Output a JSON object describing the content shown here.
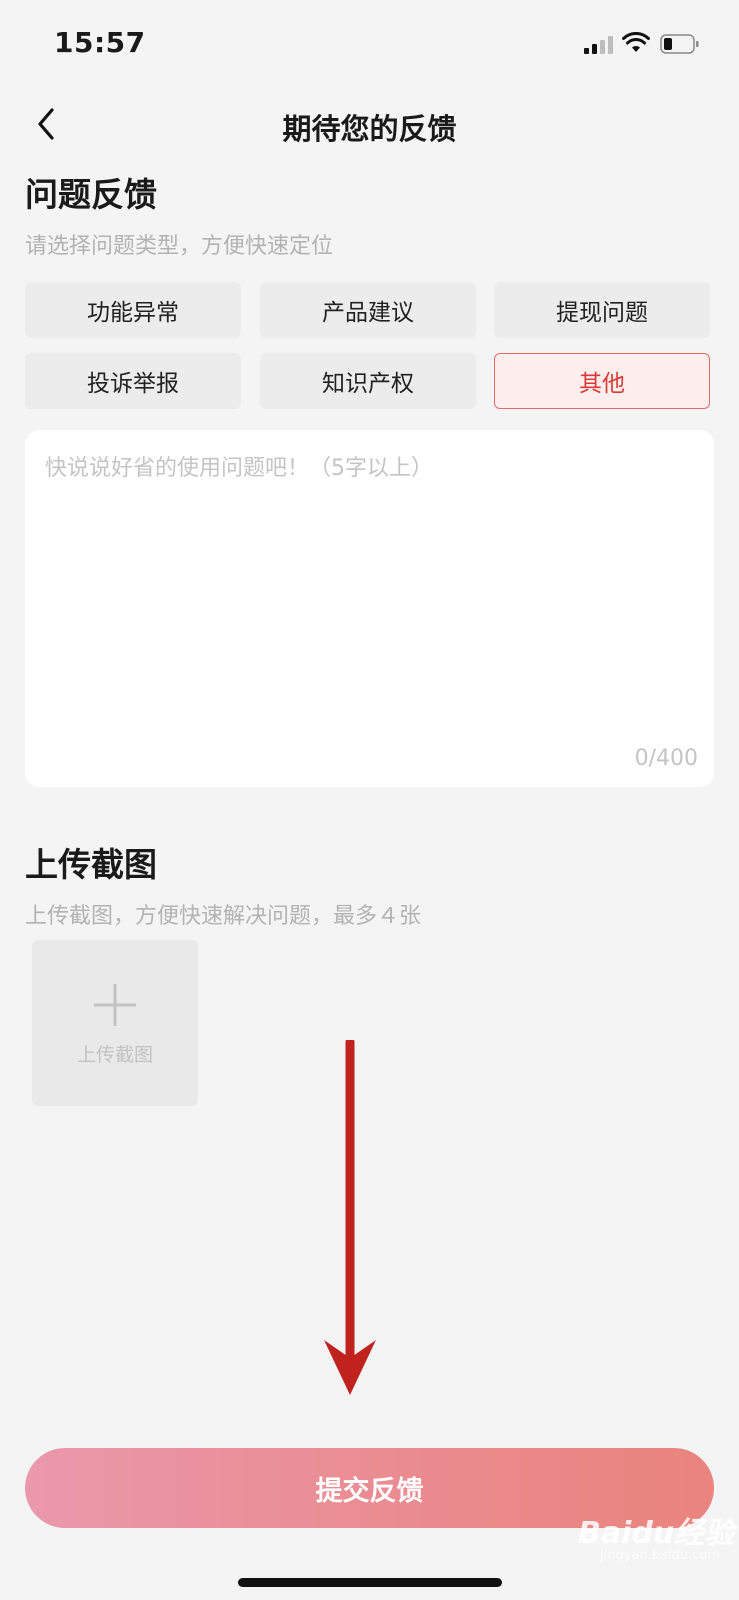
{
  "status_bar": {
    "time": "15:57"
  },
  "nav": {
    "title": "期待您的反馈"
  },
  "feedback": {
    "title": "问题反馈",
    "subtitle": "请选择问题类型，方便快速定位",
    "categories": [
      {
        "label": "功能异常",
        "selected": false
      },
      {
        "label": "产品建议",
        "selected": false
      },
      {
        "label": "提现问题",
        "selected": false
      },
      {
        "label": "投诉举报",
        "selected": false
      },
      {
        "label": "知识产权",
        "selected": false
      },
      {
        "label": "其他",
        "selected": true
      }
    ],
    "textarea_placeholder": "快说说好省的使用问题吧！（5字以上）",
    "counter": "0/400"
  },
  "upload": {
    "title": "上传截图",
    "subtitle": "上传截图，方便快速解决问题，最多４张",
    "box_label": "上传截图"
  },
  "submit": {
    "label": "提交反馈"
  },
  "watermark": {
    "text": "Baidu经验",
    "sub": "jingyan.baidu.com"
  },
  "colors": {
    "accent": "#d83a3a",
    "selected_bg": "#fdeeee",
    "button_gradient_start": "#ea98ab",
    "button_gradient_end": "#ea847d",
    "arrow": "#c0221d"
  }
}
